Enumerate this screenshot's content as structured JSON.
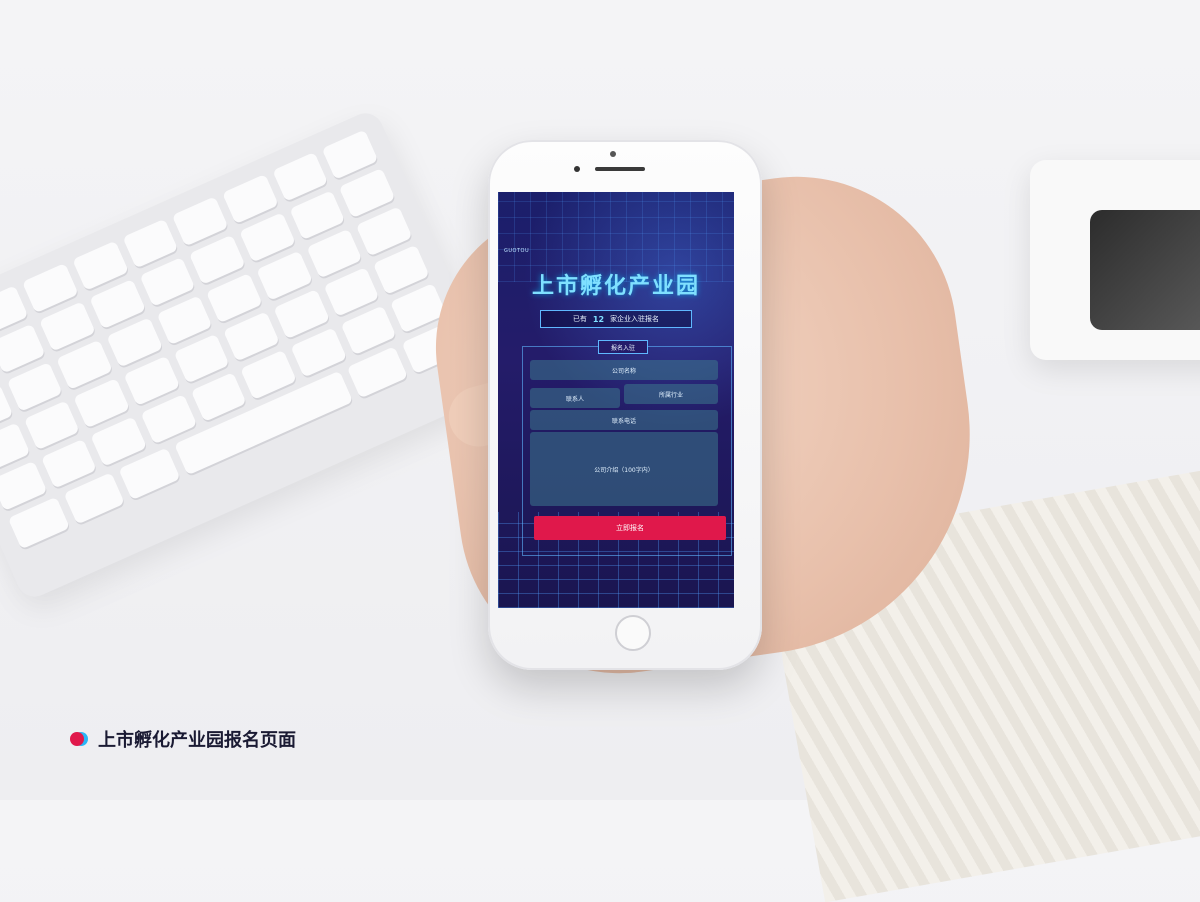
{
  "app": {
    "brand": "GUOTOU",
    "title": "上市孵化产业园",
    "count_prefix": "已有",
    "count_value": "12",
    "count_suffix": "家企业入驻报名",
    "form_badge": "报名入驻"
  },
  "form": {
    "company_name_placeholder": "公司名称",
    "contact_person_placeholder": "联系人",
    "industry_placeholder": "所属行业",
    "phone_placeholder": "联系电话",
    "company_intro_placeholder": "公司介绍（100字内）",
    "submit_label": "立即报名"
  },
  "caption": {
    "text": "上市孵化产业园报名页面"
  },
  "colors": {
    "accent_pink": "#e0184b",
    "accent_cyan": "#7fe0ff",
    "screen_bg": "#1b1f6b"
  }
}
